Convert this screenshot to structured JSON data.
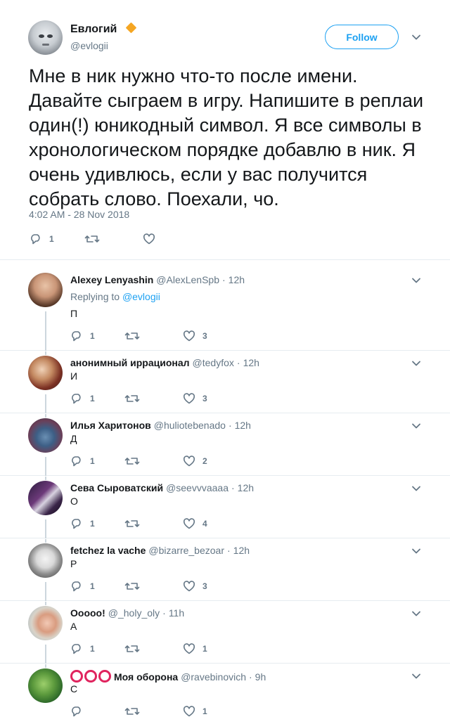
{
  "tweet": {
    "author_name": "Евлогий",
    "author_handle": "@evlogii",
    "follow_label": "Follow",
    "text": "Мне в ник нужно что-то после имени. Давайте сыграем в игру. Напишите в реплаи один(!) юникодный символ. Я все символы в хронологическом порядке добавлю в ник. Я очень удивлюсь, если у вас получится собрать слово. Поехали, чо.",
    "timestamp": "4:02 AM - 28 Nov 2018",
    "reply_count": "1",
    "retweet_count": "",
    "like_count": ""
  },
  "replies": [
    {
      "name": "Alexey Lenyashin",
      "handle": "@AlexLenSpb",
      "time": "12h",
      "replying_prefix": "Replying to",
      "replying_to": "@evlogii",
      "text": "П",
      "reply_count": "1",
      "retweet_count": "",
      "like_count": "3"
    },
    {
      "name": "анонимный иррационал",
      "handle": "@tedyfox",
      "time": "12h",
      "text": "И",
      "reply_count": "1",
      "retweet_count": "",
      "like_count": "3"
    },
    {
      "name": "Илья Харитонов",
      "handle": "@huliotebenado",
      "time": "12h",
      "text": "Д",
      "reply_count": "1",
      "retweet_count": "",
      "like_count": "2"
    },
    {
      "name": "Сева Сыроватский",
      "handle": "@seevvvaaaa",
      "time": "12h",
      "text": "О",
      "reply_count": "1",
      "retweet_count": "",
      "like_count": "4"
    },
    {
      "name": "fetchez la vache",
      "handle": "@bizarre_bezoar",
      "time": "12h",
      "text": "Р",
      "reply_count": "1",
      "retweet_count": "",
      "like_count": "3"
    },
    {
      "name": "Ooooo!",
      "handle": "@_holy_oly",
      "time": "11h",
      "text": "А",
      "reply_count": "1",
      "retweet_count": "",
      "like_count": "1"
    },
    {
      "name": "Моя оборона",
      "handle": "@ravebinovich",
      "time": "9h",
      "text": "С",
      "reply_count": "",
      "retweet_count": "",
      "like_count": "1"
    }
  ],
  "colors": {
    "text": "#14171a",
    "secondary": "#657786",
    "accent": "#1da1f2",
    "thread_line": "#ccd6dd",
    "verified_diamond": "#f5a623",
    "circles": "#e0245e"
  }
}
